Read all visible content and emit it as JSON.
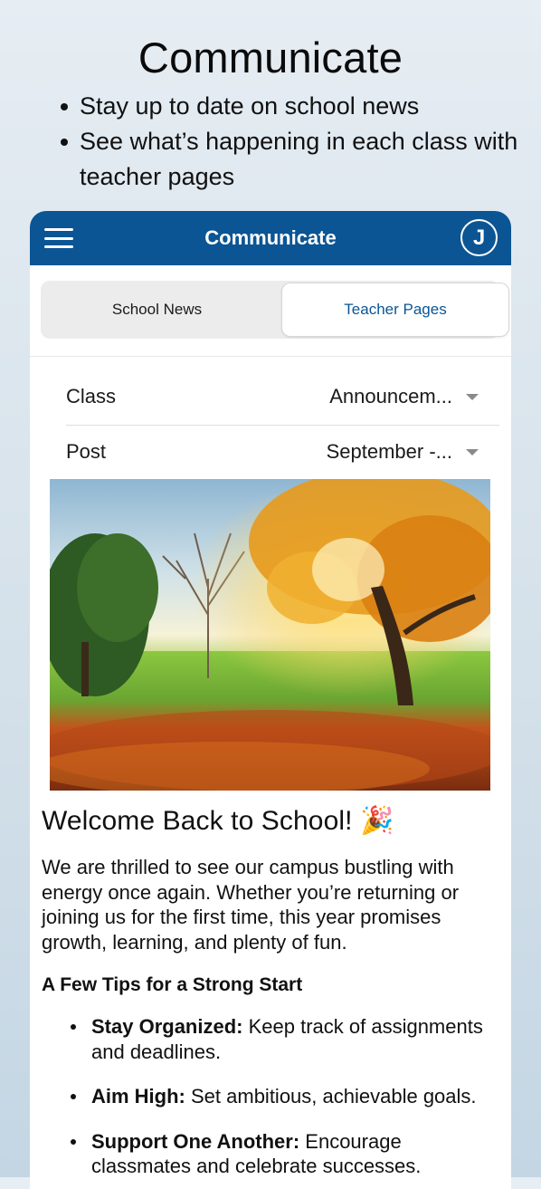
{
  "promo": {
    "title": "Communicate",
    "bullets": [
      "Stay up to date on school news",
      "See what’s happening in each class with teacher pages"
    ]
  },
  "appbar": {
    "title": "Communicate",
    "avatar_initial": "J",
    "color": "#0b5594"
  },
  "tabs": [
    {
      "label": "School News",
      "selected": false
    },
    {
      "label": "Teacher Pages",
      "selected": true
    }
  ],
  "filters": {
    "class": {
      "label": "Class",
      "value": "Announcem..."
    },
    "post": {
      "label": "Post",
      "value": "September -..."
    }
  },
  "article": {
    "title": "Welcome Back to School! 🎉",
    "body": "We are thrilled to see our campus bustling with energy once again. Whether you’re returning or joining us for the first time, this year promises growth, learning, and plenty of fun.",
    "tips_heading": "A Few Tips for a Strong Start",
    "tips": [
      {
        "lead": "Stay Organized:",
        "text": " Keep track of assignments and deadlines."
      },
      {
        "lead": "Aim High:",
        "text": " Set ambitious, achievable goals."
      },
      {
        "lead": "Support One Another:",
        "text": " Encourage classmates and celebrate successes."
      }
    ]
  },
  "icons": [
    "menu-icon",
    "avatar",
    "chevron-down-icon"
  ]
}
